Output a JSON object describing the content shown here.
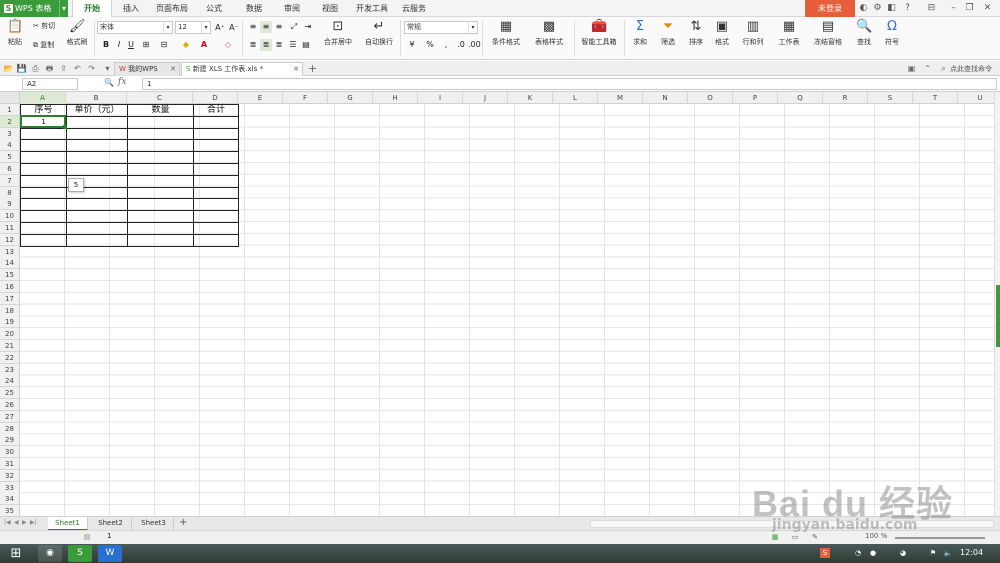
{
  "app": {
    "name": "WPS 表格",
    "login": "未登录"
  },
  "ribbon_tabs": [
    "开始",
    "插入",
    "页面布局",
    "公式",
    "数据",
    "审阅",
    "视图",
    "开发工具",
    "云服务"
  ],
  "ribbon": {
    "paste": "粘贴",
    "cut": "剪切",
    "copy": "复制",
    "format_painter": "格式刷",
    "font_name": "宋体",
    "font_size": "12",
    "bold": "B",
    "italic": "I",
    "underline": "U",
    "merge": "合并居中",
    "wrap": "自动换行",
    "number_format": "常规",
    "percent": "%",
    "cond_format": "条件格式",
    "table_style": "表格样式",
    "smart_toolbox": "智能工具箱",
    "sum": "求和",
    "filter": "筛选",
    "sort": "排序",
    "format": "格式",
    "rows_cols": "行和列",
    "worksheet": "工作表",
    "freeze": "冻结窗格",
    "find": "查找",
    "symbol": "符号"
  },
  "doc_tabs": [
    {
      "label": "我的WPS"
    },
    {
      "label": "新建 XLS 工作表.xls *"
    }
  ],
  "search_placeholder": "点此查找命令",
  "formula": {
    "cell_ref": "A2",
    "fx": "fx",
    "value": "1"
  },
  "columns": [
    "A",
    "B",
    "C",
    "D",
    "E",
    "F",
    "G",
    "H",
    "I",
    "J",
    "K",
    "L",
    "M",
    "N",
    "O",
    "P",
    "Q",
    "R",
    "S",
    "T",
    "U"
  ],
  "rows": [
    "1",
    "2",
    "3",
    "4",
    "5",
    "6",
    "7",
    "8",
    "9",
    "10",
    "11",
    "12",
    "13",
    "14",
    "15",
    "16",
    "17",
    "18",
    "19",
    "20",
    "21",
    "22",
    "23",
    "24",
    "25",
    "26",
    "27",
    "28",
    "29",
    "30",
    "31",
    "32",
    "33",
    "34",
    "35"
  ],
  "table": {
    "headers": [
      "序号",
      "单价（元）",
      "数量",
      "合计"
    ],
    "cells": [
      [
        "1",
        "",
        "",
        ""
      ],
      [
        "",
        "",
        "",
        ""
      ],
      [
        "",
        "",
        "",
        ""
      ],
      [
        "",
        "",
        "",
        ""
      ],
      [
        "",
        "",
        "",
        ""
      ],
      [
        "",
        "",
        "",
        ""
      ],
      [
        "",
        "",
        "",
        ""
      ],
      [
        "",
        "",
        "",
        ""
      ],
      [
        "",
        "",
        "",
        ""
      ],
      [
        "",
        "",
        "",
        ""
      ],
      [
        "",
        "",
        "",
        ""
      ]
    ]
  },
  "autofill_tooltip": "5",
  "sheets": [
    "Sheet1",
    "Sheet2",
    "Sheet3"
  ],
  "status": {
    "value": "1",
    "zoom": "100 %"
  },
  "clock": "12:04",
  "watermark": {
    "brand": "Bai du 经验",
    "url": "jingyan.baidu.com"
  }
}
